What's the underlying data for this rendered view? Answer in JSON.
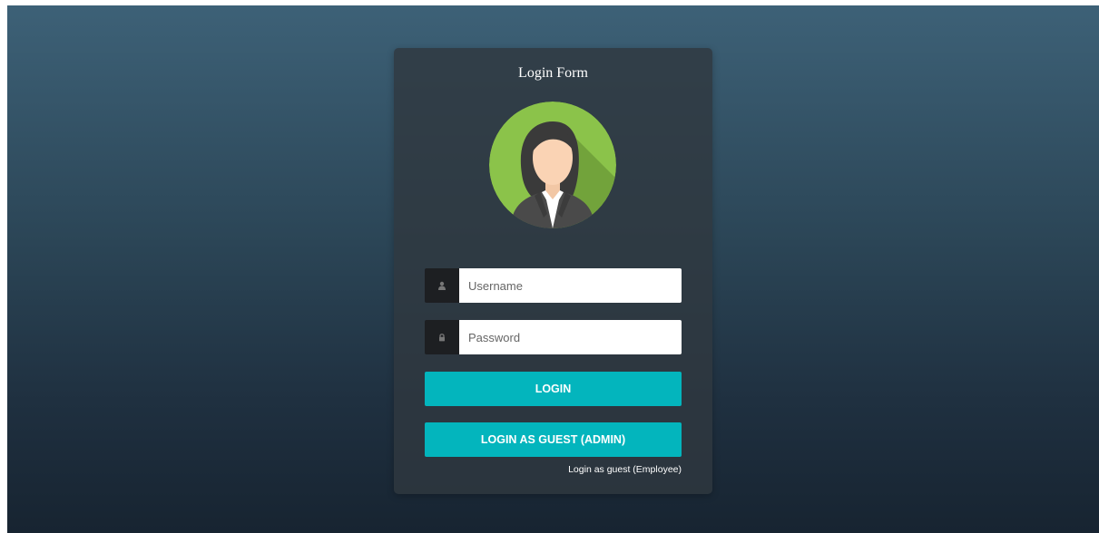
{
  "login_form": {
    "title": "Login Form",
    "username": {
      "placeholder": "Username",
      "value": "",
      "icon": "user-icon"
    },
    "password": {
      "placeholder": "Password",
      "value": "",
      "icon": "lock-icon"
    },
    "login_button_label": "LOGIN",
    "guest_admin_button_label": "LOGIN AS GUEST (ADMIN)",
    "guest_employee_link_label": "Login as guest (Employee)"
  },
  "avatar": {
    "icon": "female-user-avatar-icon",
    "background_color": "#8bc34a"
  },
  "colors": {
    "background_top": "#3d6177",
    "background_bottom": "#172431",
    "card": "#303840",
    "accent": "#03b5bd",
    "addon": "#1d1f22"
  }
}
